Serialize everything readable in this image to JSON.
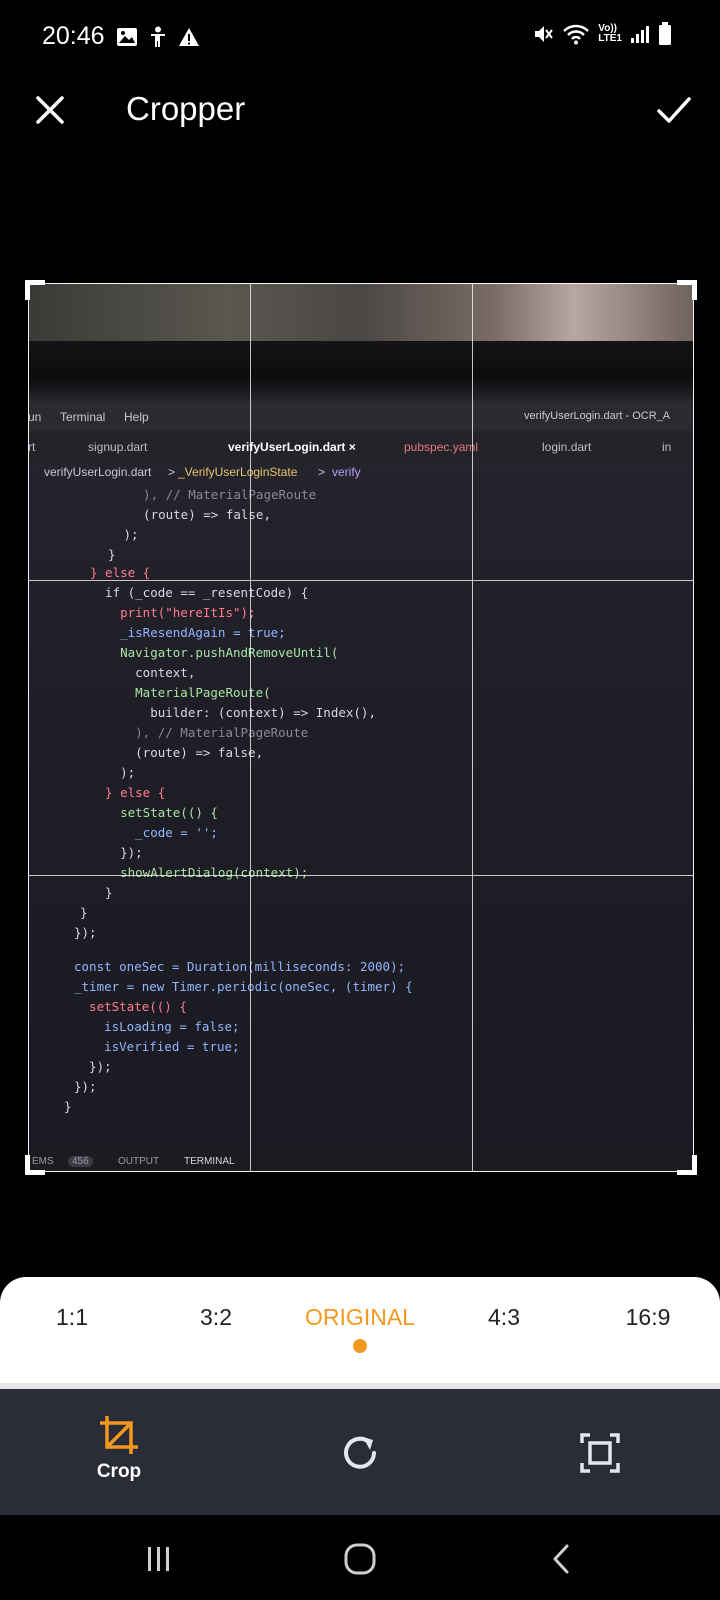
{
  "status_bar": {
    "time": "20:46",
    "left_icons": [
      "image-icon",
      "accessibility-icon",
      "warning-icon"
    ],
    "right_icons": [
      "mute-icon",
      "wifi-icon",
      "volte-icon",
      "signal-icon",
      "battery-icon"
    ],
    "volte_text": "Vo))",
    "lte_text": "LTE1"
  },
  "header": {
    "title": "Cropper",
    "close_icon": "close-icon",
    "confirm_icon": "check-icon"
  },
  "photo": {
    "menubar": [
      "un",
      "Terminal",
      "Help"
    ],
    "window_title": "verifyUserLogin.dart - OCR_A",
    "tabs": [
      "rt",
      "signup.dart",
      "verifyUserLogin.dart ×",
      "pubspec.yaml",
      "login.dart",
      "in"
    ],
    "breadcrumb": [
      "verifyUserLogin.dart",
      ">",
      "_VerifyUserLoginState",
      ">",
      "verify"
    ],
    "code_lines": [
      "  ), // MaterialPageRoute",
      "  (route) => false,",
      " );",
      "}",
      "} else {",
      "  if (_code == _resentCode) {",
      "    print(\"hereItIs\");",
      "    _isResendAgain = true;",
      "    Navigator.pushAndRemoveUntil(",
      "      context,",
      "      MaterialPageRoute(",
      "        builder: (context) => Index(),",
      "      ), // MaterialPageRoute",
      "      (route) => false,",
      "    );",
      "  } else {",
      "    setState(() {",
      "      _code = '';",
      "    });",
      "    showAlertDialog(context);",
      "  }",
      "}",
      "});",
      "const oneSec = Duration(milliseconds: 2000);",
      "_timer = new Timer.periodic(oneSec, (timer) {",
      "  setState(() {",
      "    isLoading = false;",
      "    isVerified = true;",
      "  });",
      "});",
      "}"
    ],
    "statusbar": [
      "EMS",
      "456",
      "OUTPUT",
      "TERMINAL"
    ]
  },
  "ratios": [
    "1:1",
    "3:2",
    "ORIGINAL",
    "4:3",
    "16:9"
  ],
  "active_ratio": "ORIGINAL",
  "accent_color": "#f29a1f",
  "tools": {
    "crop_label": "Crop",
    "crop_icon": "crop-icon",
    "rotate_icon": "rotate-icon",
    "fit_icon": "fit-screen-icon"
  },
  "navbar": {
    "recents_icon": "recents-icon",
    "home_icon": "home-icon",
    "back_icon": "back-icon"
  }
}
